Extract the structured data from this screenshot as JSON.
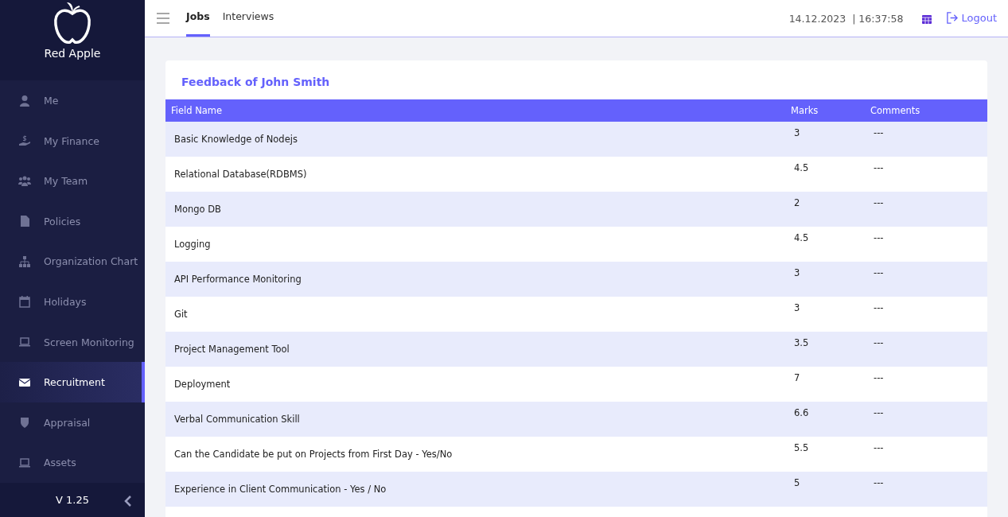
{
  "brand": {
    "name": "Red Apple"
  },
  "sidebar": {
    "items": [
      {
        "label": "Me",
        "selected": false
      },
      {
        "label": "My Finance",
        "selected": false
      },
      {
        "label": "My Team",
        "selected": false
      },
      {
        "label": "Policies",
        "selected": false
      },
      {
        "label": "Organization Chart",
        "selected": false
      },
      {
        "label": "Holidays",
        "selected": false
      },
      {
        "label": "Screen Monitoring",
        "selected": false
      },
      {
        "label": "Recruitment",
        "selected": true
      },
      {
        "label": "Appraisal",
        "selected": false
      },
      {
        "label": "Assets",
        "selected": false
      }
    ],
    "version": "V 1.25"
  },
  "tabs": [
    {
      "label": "Jobs",
      "selected": true
    },
    {
      "label": "Interviews",
      "selected": false
    }
  ],
  "header": {
    "date": "14.12.2023",
    "separator": "|",
    "time": "16:37:58",
    "logout": "Logout"
  },
  "feedback": {
    "title": "Feedback of John Smith",
    "columns": [
      "Field Name",
      "Marks",
      "Comments"
    ],
    "rows": [
      [
        "Basic Knowledge of Nodejs",
        "3",
        "---"
      ],
      [
        "Relational Database(RDBMS)",
        "4.5",
        "---"
      ],
      [
        "Mongo DB",
        "2",
        "---"
      ],
      [
        "Logging",
        "4.5",
        "---"
      ],
      [
        "API Performance Monitoring",
        "3",
        "---"
      ],
      [
        "Git",
        "3",
        "---"
      ],
      [
        "Project Management Tool",
        "3.5",
        "---"
      ],
      [
        "Deployment",
        "7",
        "---"
      ],
      [
        "Verbal Communication Skill",
        "6.6",
        "---"
      ],
      [
        "Can the Candidate be put on Projects from First Day - Yes/No",
        "5.5",
        "---"
      ],
      [
        "Experience in Client Communication - Yes / No",
        "5",
        "---"
      ]
    ]
  }
}
